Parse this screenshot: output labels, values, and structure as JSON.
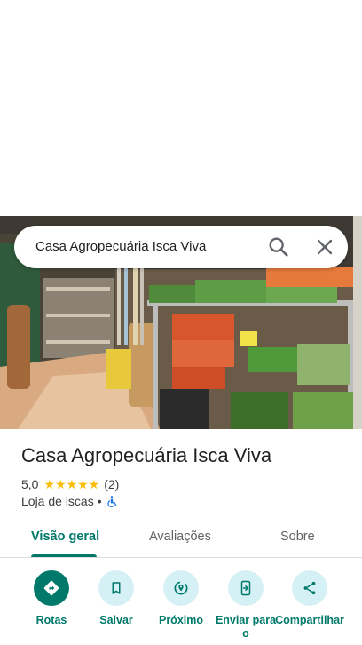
{
  "search": {
    "query": "Casa Agropecuária Isca Viva"
  },
  "place": {
    "name": "Casa Agropecuária Isca Viva",
    "rating": "5,0",
    "stars": "★★★★★",
    "review_count": "(2)",
    "category": "Loja de iscas",
    "separator": "•"
  },
  "tabs": [
    {
      "label": "Visão geral",
      "active": true
    },
    {
      "label": "Avaliações",
      "active": false
    },
    {
      "label": "Sobre",
      "active": false
    }
  ],
  "actions": [
    {
      "label": "Rotas",
      "icon": "directions-icon"
    },
    {
      "label": "Salvar",
      "icon": "bookmark-icon"
    },
    {
      "label": "Próximo",
      "icon": "nearby-icon"
    },
    {
      "label": "Enviar para o",
      "icon": "send-to-phone-icon"
    },
    {
      "label": "Compartilhar",
      "icon": "share-icon"
    }
  ],
  "colors": {
    "accent": "#00796b",
    "action_bg": "#d6f1f6",
    "stars": "#fbbc04",
    "accessibility": "#1a73e8"
  }
}
